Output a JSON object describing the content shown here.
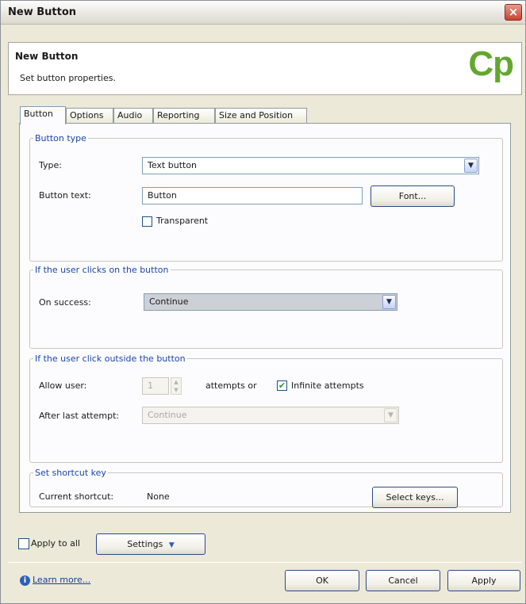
{
  "window": {
    "title": "New Button"
  },
  "header": {
    "title": "New Button",
    "subtitle": "Set button properties.",
    "logo_text": "Cp"
  },
  "tabs": [
    {
      "label": "Button"
    },
    {
      "label": "Options"
    },
    {
      "label": "Audio"
    },
    {
      "label": "Reporting"
    },
    {
      "label": "Size and Position"
    }
  ],
  "button_type": {
    "legend": "Button type",
    "type_label": "Type:",
    "type_value": "Text button",
    "text_label": "Button text:",
    "text_value": "Button",
    "font_button": "Font...",
    "transparent_label": "Transparent",
    "transparent_checked": false
  },
  "user_clicks": {
    "legend": "If the user clicks on the button",
    "on_success_label": "On success:",
    "on_success_value": "Continue"
  },
  "user_click_outside": {
    "legend": "If the user click outside the button",
    "allow_label": "Allow user:",
    "attempts_value": "1",
    "attempts_suffix": "attempts or",
    "infinite_label": "Infinite attempts",
    "infinite_checked": true,
    "after_last_label": "After last attempt:",
    "after_last_value": "Continue"
  },
  "shortcut": {
    "legend": "Set shortcut key",
    "current_label": "Current shortcut:",
    "current_value": "None",
    "select_keys_button": "Select keys..."
  },
  "bottom": {
    "apply_to_all_label": "Apply to all",
    "settings_button": "Settings",
    "learn_more": "Learn more...",
    "ok_button": "OK",
    "cancel_button": "Cancel",
    "apply_button": "Apply"
  },
  "colors": {
    "logo": "#63a72f",
    "legend": "#1c46a8",
    "close": "#c8432c"
  }
}
